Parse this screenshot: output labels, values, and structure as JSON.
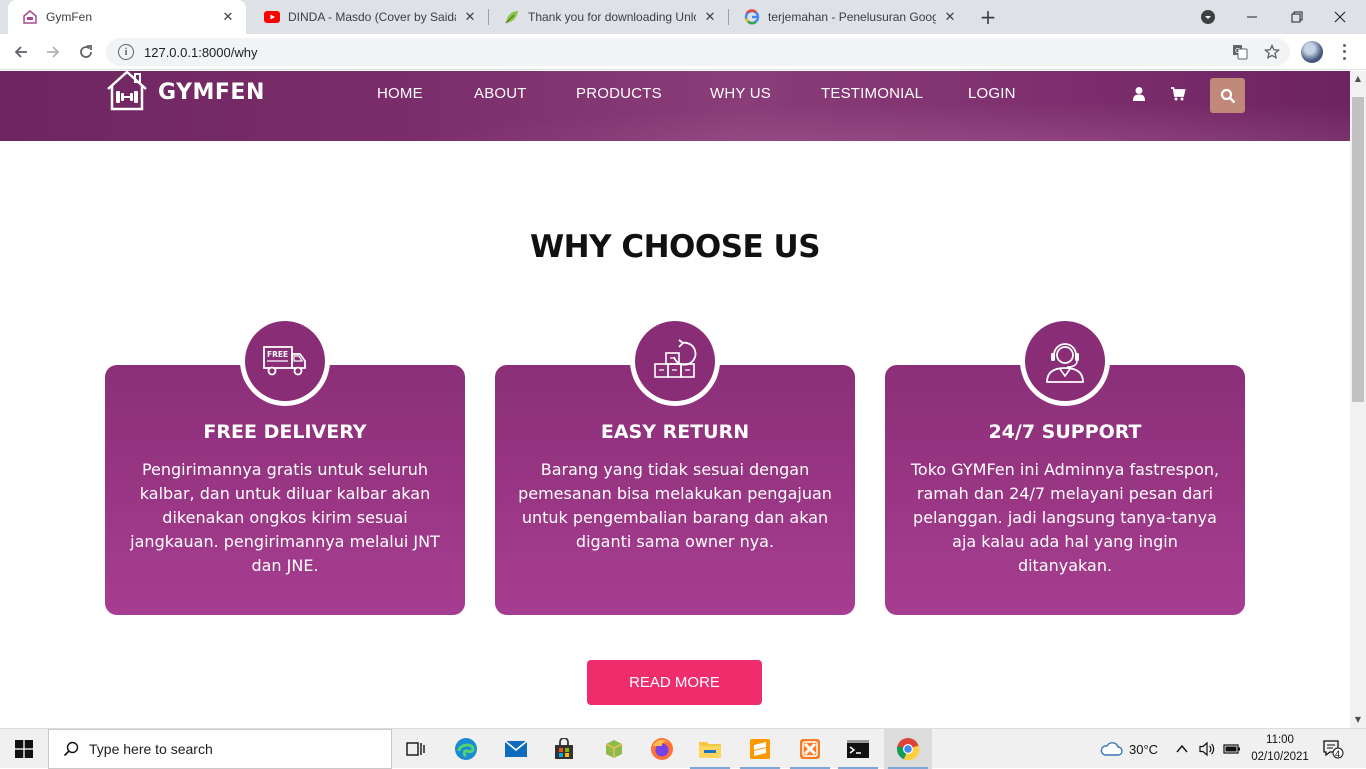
{
  "browser": {
    "tabs": [
      {
        "title": "GymFen",
        "active": true
      },
      {
        "title": "DINDA - Masdo (Cover by Saidah",
        "active": false
      },
      {
        "title": "Thank you for downloading Unlo",
        "active": false
      },
      {
        "title": "terjemahan - Penelusuran Google",
        "active": false
      }
    ],
    "url": "127.0.0.1:8000/why"
  },
  "site": {
    "logo_text": "GYMFEN",
    "nav": [
      "HOME",
      "ABOUT",
      "PRODUCTS",
      "WHY US",
      "TESTIMONIAL",
      "LOGIN"
    ],
    "section_title": "WHY CHOOSE US",
    "cards": [
      {
        "icon": "free-delivery-truck-icon",
        "title": "FREE DELIVERY",
        "text": "Pengirimannya gratis untuk seluruh kalbar, dan untuk diluar kalbar akan dikenakan ongkos kirim sesuai jangkauan. pengirimannya melalui JNT dan JNE.",
        "free_badge": "FREE"
      },
      {
        "icon": "easy-return-boxes-icon",
        "title": "EASY RETURN",
        "text": "Barang yang tidak sesuai dengan pemesanan bisa melakukan pengajuan untuk pengembalian barang dan akan diganti sama owner nya."
      },
      {
        "icon": "support-headset-icon",
        "title": "24/7 SUPPORT",
        "text": "Toko GYMFen ini Adminnya fastrespon, ramah dan 24/7 melayani pesan dari pelanggan. jadi langsung tanya-tanya aja kalau ada hal yang ingin ditanyakan."
      }
    ],
    "read_more": "READ MORE",
    "colors": {
      "header": "#7a2d6a",
      "card": "#9a3585",
      "button": "#ef2c6c",
      "search": "#c08878"
    }
  },
  "taskbar": {
    "search_placeholder": "Type here to search",
    "weather": "30°C",
    "time": "11:00",
    "date": "02/10/2021",
    "notifications": "4"
  }
}
